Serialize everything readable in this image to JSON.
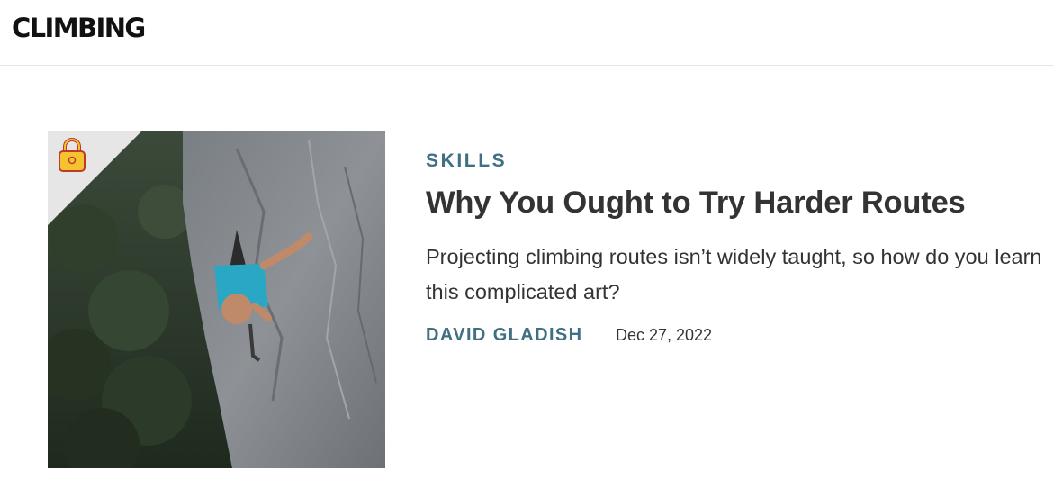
{
  "site": {
    "logo_text": "CLIMBING"
  },
  "article": {
    "category": "SKILLS",
    "title": "Why You Ought to Try Harder Routes",
    "dek": "Projecting climbing routes isn’t widely taught, so how do you learn this complicated art?",
    "author": "DAVID GLADISH",
    "date": "Dec 27, 2022",
    "image_icon": "lock-icon",
    "locked": true
  },
  "colors": {
    "accent": "#3f6f82",
    "text": "#333333",
    "lock_body": "#f4c430",
    "lock_outline": "#c0392b"
  }
}
